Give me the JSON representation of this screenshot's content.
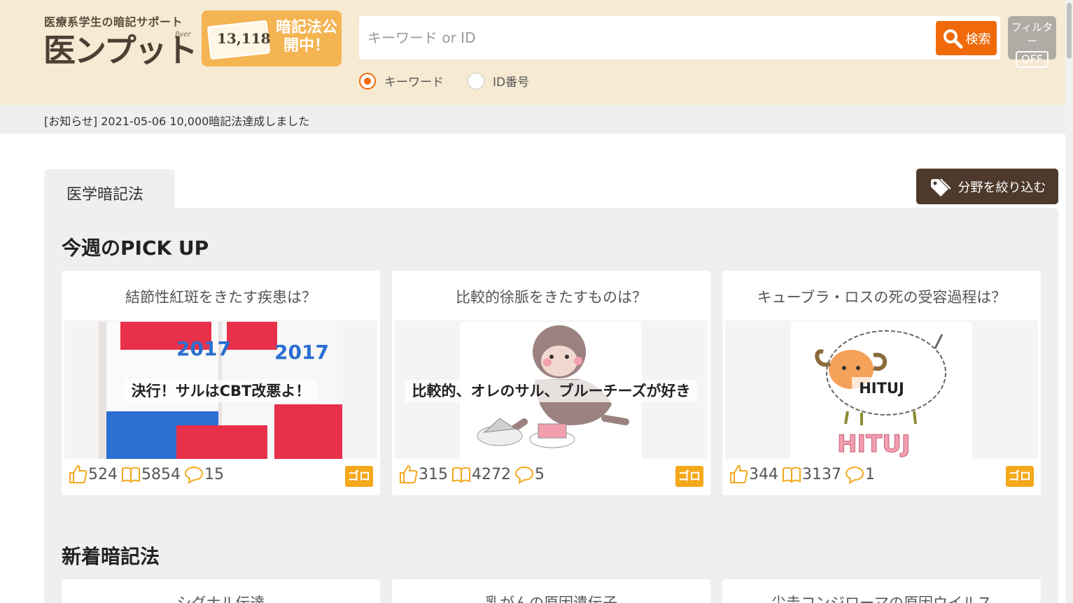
{
  "header": {
    "logo_subtitle": "医療系学生の暗記サポート",
    "logo_title": "医ンプット",
    "logo_version": "βver",
    "promo_count": "13,118",
    "promo_text": "暗記法公開中！",
    "search_placeholder": "キーワード or ID",
    "search_button": "検索",
    "filter_label": "フィルター",
    "filter_state": "OFF",
    "radio_options": [
      "キーワード",
      "ID番号"
    ],
    "radio_selected": "キーワード"
  },
  "notice": "[お知らせ] 2021-05-06 10,000暗記法達成しました",
  "tab_label": "医学暗記法",
  "filter_category_button": "分野を絞り込む",
  "pickup": {
    "title": "今週のPICK UP",
    "cards": [
      {
        "title": "結節性紅斑をきたす疾患は？",
        "caption": "決行！サルはCBT改悪よ！",
        "likes": "524",
        "views": "5854",
        "comments": "15",
        "badge": "ゴロ"
      },
      {
        "title": "比較的徐脈をきたすものは？",
        "caption": "比較的、オレのサル、ブルーチーズが好き",
        "likes": "315",
        "views": "4272",
        "comments": "5",
        "badge": "ゴロ"
      },
      {
        "title": "キューブラ・ロスの死の受容過程は？",
        "caption": "HITUJ",
        "likes": "344",
        "views": "3137",
        "comments": "1",
        "badge": "ゴロ"
      }
    ]
  },
  "new": {
    "title": "新着暗記法",
    "cards": [
      {
        "title": "シグナル伝達"
      },
      {
        "title": "乳がんの原因遺伝子"
      },
      {
        "title": "尖圭コンジローマの原因ウイルス"
      }
    ]
  },
  "colors": {
    "accent": "#f06a0a",
    "header_bg": "#f6ead2",
    "badge": "#f4a81c",
    "dark_button": "#4d3a2c"
  }
}
